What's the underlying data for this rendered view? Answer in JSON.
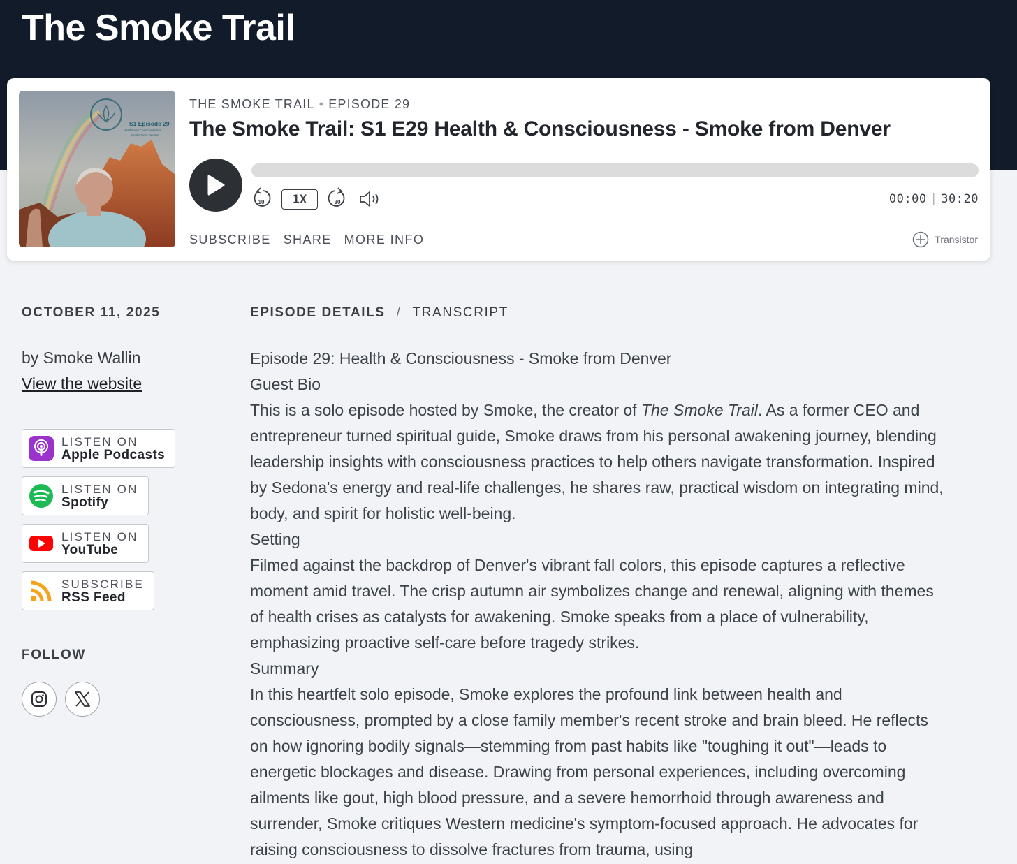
{
  "site": {
    "title": "The Smoke Trail"
  },
  "player": {
    "show_name": "THE SMOKE TRAIL",
    "episode_label": "EPISODE 29",
    "title": "The Smoke Trail: S1 E29 Health & Consciousness - Smoke from Denver",
    "artwork": {
      "badge_line1": "S1 Episode 29",
      "badge_line2": "Health and Consciousness",
      "badge_line3": "Smoke from Denver"
    },
    "speed": "1X",
    "rewind_seconds": "10",
    "forward_seconds": "30",
    "current_time": "00:00",
    "duration": "30:20",
    "progress": 0,
    "links": {
      "subscribe": "SUBSCRIBE",
      "share": "SHARE",
      "more_info": "MORE INFO"
    },
    "brand": "Transistor"
  },
  "sidebar": {
    "date": "OCTOBER 11, 2025",
    "author": "by Smoke Wallin",
    "website_link": "View the website",
    "listen": [
      {
        "small": "LISTEN ON",
        "big": "Apple Podcasts",
        "icon": "apple-podcasts-icon",
        "color": "#9933cc"
      },
      {
        "small": "LISTEN ON",
        "big": "Spotify",
        "icon": "spotify-icon",
        "color": "#1db954"
      },
      {
        "small": "LISTEN ON",
        "big": "YouTube",
        "icon": "youtube-icon",
        "color": "#ff0000"
      },
      {
        "small": "SUBSCRIBE",
        "big": "RSS Feed",
        "icon": "rss-icon",
        "color": "#f7a21b"
      }
    ],
    "follow_label": "FOLLOW",
    "social": [
      "instagram-icon",
      "x-icon"
    ]
  },
  "tabs": {
    "details": "EPISODE DETAILS",
    "separator": "/",
    "transcript": "TRANSCRIPT"
  },
  "details": {
    "heading": "Episode 29: Health & Consciousness - Smoke from Denver",
    "guest_bio_title": "Guest Bio",
    "guest_bio_pre": "This is a solo episode hosted by Smoke, the creator of ",
    "guest_bio_em": "The Smoke Trail",
    "guest_bio_post": ". As a former CEO and entrepreneur turned spiritual guide, Smoke draws from his personal awakening journey, blending leadership insights with consciousness practices to help others navigate transformation. Inspired by Sedona's energy and real-life challenges, he shares raw, practical wisdom on integrating mind, body, and spirit for holistic well-being.",
    "setting_title": "Setting",
    "setting": "Filmed against the backdrop of Denver's vibrant fall colors, this episode captures a reflective moment amid travel. The crisp autumn air symbolizes change and renewal, aligning with themes of health crises as catalysts for awakening. Smoke speaks from a place of vulnerability, emphasizing proactive self-care before tragedy strikes.",
    "summary_title": "Summary",
    "summary": "In this heartfelt solo episode, Smoke explores the profound link between health and consciousness, prompted by a close family member's recent stroke and brain bleed. He reflects on how ignoring bodily signals—stemming from past habits like \"toughing it out\"—leads to energetic blockages and disease. Drawing from personal experiences, including overcoming ailments like gout, high blood pressure, and a severe hemorrhoid through awareness and surrender, Smoke critiques Western medicine's symptom-focused approach. He advocates for raising consciousness to dissolve fractures from trauma, using"
  }
}
